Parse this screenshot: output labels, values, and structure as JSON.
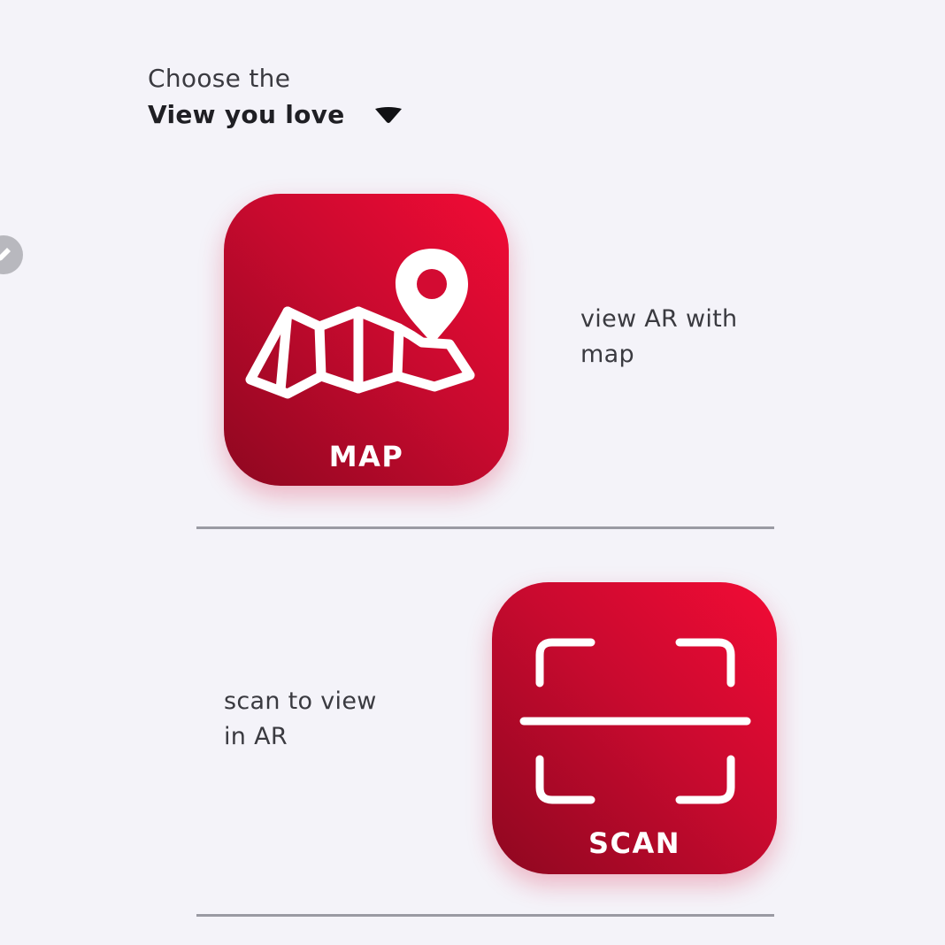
{
  "header": {
    "line1": "Choose the",
    "line2": "View you love",
    "dropdown_icon": "caret-down-icon"
  },
  "side_control": {
    "icon": "edit-icon"
  },
  "options": [
    {
      "label": "MAP",
      "icon": "folded-map-with-pin-icon",
      "description": "view AR with\nmap"
    },
    {
      "label": "SCAN",
      "icon": "scan-frame-icon",
      "description": "scan to view\nin AR"
    }
  ],
  "colors": {
    "background": "#f4f3f9",
    "tile_gradient_start": "#f20b35",
    "tile_gradient_end": "#8e0720",
    "divider": "#9a9aa3",
    "text": "#3a3a40"
  }
}
